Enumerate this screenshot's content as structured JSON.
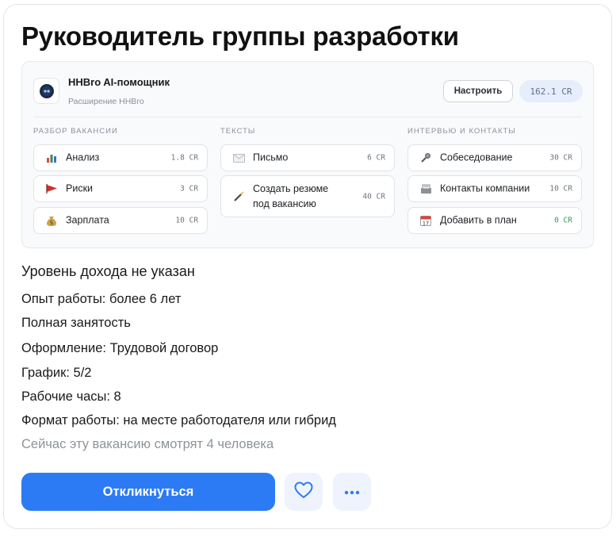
{
  "vacancy": {
    "title": "Руководитель группы разработки",
    "salary": "Уровень дохода не указан",
    "details": [
      "Опыт работы: более 6 лет",
      "Полная занятость",
      "Оформление: Трудовой договор",
      "График: 5/2",
      "Рабочие часы: 8",
      "Формат работы: на месте работодателя или гибрид"
    ],
    "viewers": "Сейчас эту вакансию смотрят 4 человека"
  },
  "extension": {
    "name": "HHBro AI-помощник",
    "subtitle": "Расширение HHBro",
    "logo_icon": "hhbro-logo-icon",
    "settings_label": "Настроить",
    "balance": "162.1 CR",
    "sections": [
      {
        "heading": "РАЗБОР ВАКАНСИИ",
        "tools": [
          {
            "icon": "bar-chart-icon",
            "label": "Анализ",
            "cost": "1.8 CR"
          },
          {
            "icon": "red-flag-icon",
            "label": "Риски",
            "cost": "3 CR"
          },
          {
            "icon": "money-bag-icon",
            "label": "Зарплата",
            "cost": "10 CR"
          }
        ]
      },
      {
        "heading": "ТЕКСТЫ",
        "tools": [
          {
            "icon": "envelope-icon",
            "label": "Письмо",
            "cost": "6 CR"
          },
          {
            "icon": "magic-wand-icon",
            "label_line1": "Создать резюме",
            "label_line2": "под вакансию",
            "cost": "40 CR"
          }
        ]
      },
      {
        "heading": "ИНТЕРВЬЮ И КОНТАКТЫ",
        "tools": [
          {
            "icon": "microphone-icon",
            "label": "Собеседование",
            "cost": "30 CR"
          },
          {
            "icon": "card-index-icon",
            "label": "Контакты компании",
            "cost": "10 CR"
          },
          {
            "icon": "calendar-icon",
            "label": "Добавить в план",
            "cost": "0 CR"
          }
        ]
      }
    ]
  },
  "actions": {
    "respond_label": "Откликнуться",
    "favorite_icon": "heart-icon",
    "more_icon": "more-dots-icon"
  },
  "colors": {
    "primary": "#2d7bf4",
    "free_cost": "#2f9a5c",
    "muted_text": "#8d939a"
  }
}
